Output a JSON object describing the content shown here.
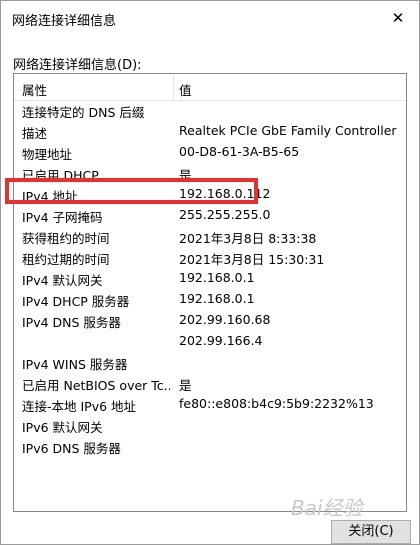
{
  "window": {
    "title": "网络连接详细信息",
    "close_glyph": "✕"
  },
  "label": "网络连接详细信息(D):",
  "columns": {
    "property": "属性",
    "value": "值"
  },
  "rows": [
    {
      "prop": "连接特定的 DNS 后缀",
      "val": ""
    },
    {
      "prop": "描述",
      "val": "Realtek PCIe GbE Family Controller"
    },
    {
      "prop": "物理地址",
      "val": "00-D8-61-3A-B5-65"
    },
    {
      "prop": "已启用 DHCP",
      "val": "是"
    },
    {
      "prop": "IPv4 地址",
      "val": "192.168.0.112"
    },
    {
      "prop": "IPv4 子网掩码",
      "val": "255.255.255.0"
    },
    {
      "prop": "获得租约的时间",
      "val": "2021年3月8日 8:33:38"
    },
    {
      "prop": "租约过期的时间",
      "val": "2021年3月8日 15:30:31"
    },
    {
      "prop": "IPv4 默认网关",
      "val": "192.168.0.1"
    },
    {
      "prop": "IPv4 DHCP 服务器",
      "val": "192.168.0.1"
    },
    {
      "prop": "IPv4 DNS 服务器",
      "val": "202.99.160.68"
    },
    {
      "prop": "",
      "val": "202.99.166.4"
    },
    {
      "prop": "IPv4 WINS 服务器",
      "val": ""
    },
    {
      "prop": "已启用 NetBIOS over Tc...",
      "val": "是"
    },
    {
      "prop": "连接-本地 IPv6 地址",
      "val": "fe80::e808:b4c9:5b9:2232%13"
    },
    {
      "prop": "IPv6 默认网关",
      "val": ""
    },
    {
      "prop": "IPv6 DNS 服务器",
      "val": ""
    }
  ],
  "buttons": {
    "close": "关闭(C)"
  },
  "watermark": "Bai经验",
  "colors": {
    "highlight": "#e8302e"
  }
}
